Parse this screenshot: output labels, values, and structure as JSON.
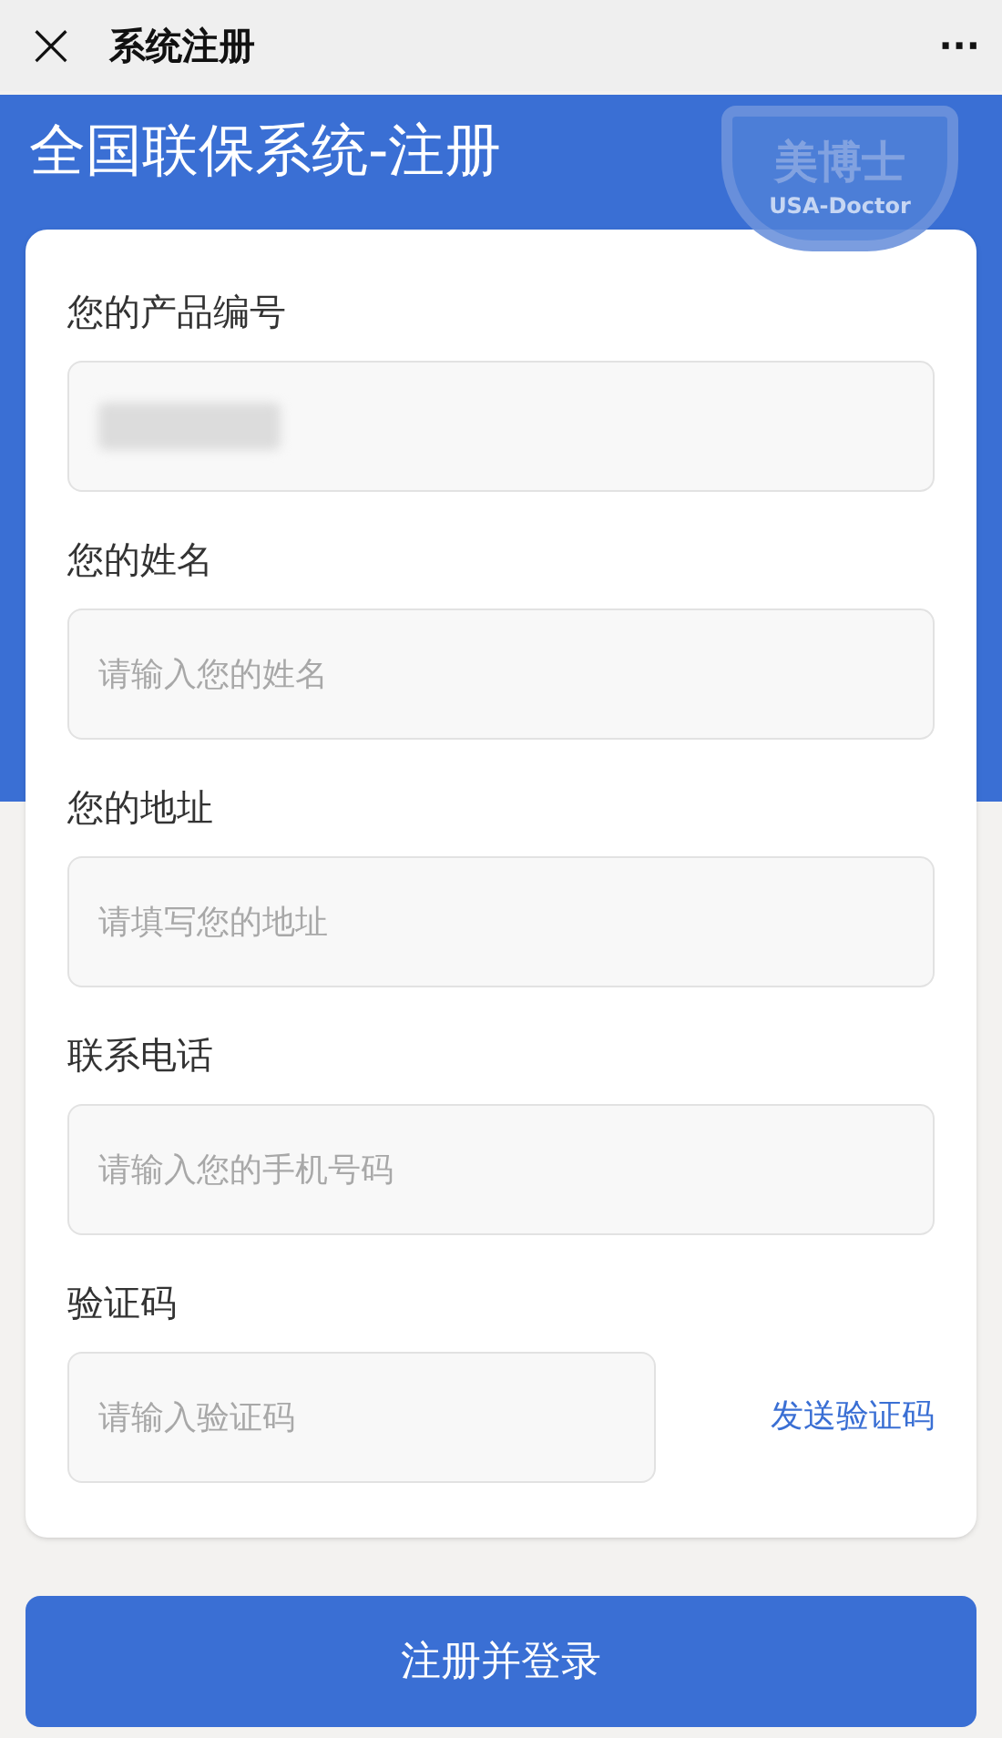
{
  "nav_bar": {
    "close": "×",
    "title": "系统注册",
    "more": "···"
  },
  "banner": {
    "title": "全国联保系统-注册",
    "logo": {
      "name": "美博士",
      "subtitle": "USA-Doctor"
    }
  },
  "form": {
    "fields": [
      {
        "kind": "masked",
        "label": "您的产品编号",
        "masked": true
      },
      {
        "kind": "text",
        "label": "您的姓名",
        "placeholder": "请输入您的姓名"
      },
      {
        "kind": "text",
        "label": "您的地址",
        "placeholder": "请填写您的地址"
      },
      {
        "kind": "text",
        "label": "联系电话",
        "placeholder": "请输入您的手机号码"
      },
      {
        "kind": "code",
        "label": "验证码",
        "placeholder": "请输入验证码",
        "action": "发送验证码"
      }
    ]
  },
  "submit_button": "注册并登录"
}
